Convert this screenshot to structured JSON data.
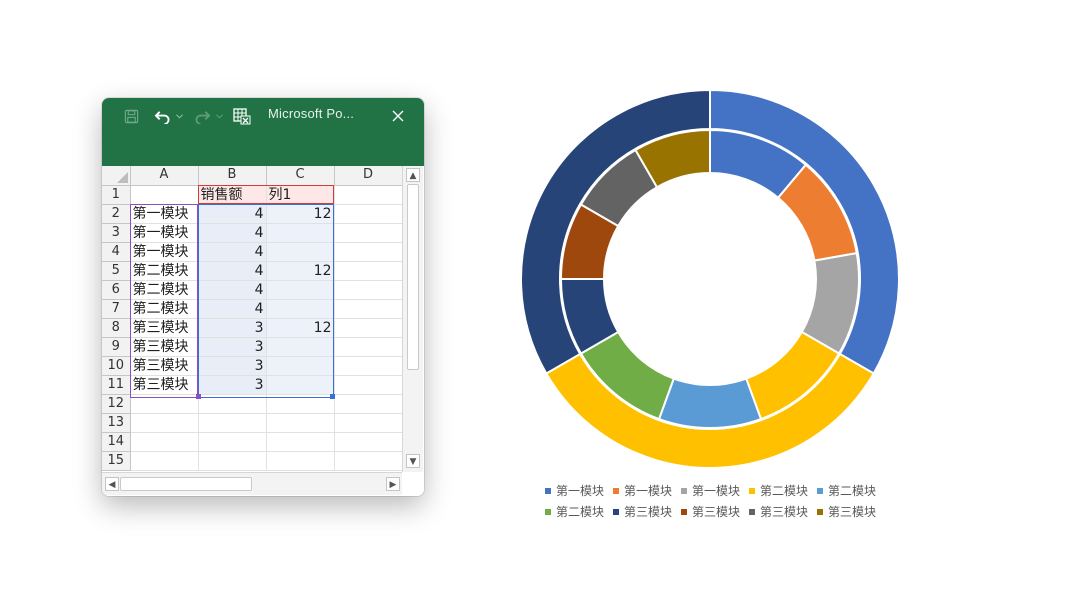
{
  "window": {
    "title": "Microsoft Po...",
    "icons": [
      "save-icon",
      "undo-icon",
      "undo-dropdown-icon",
      "redo-icon",
      "redo-dropdown-icon",
      "spreadsheet-icon",
      "close-icon"
    ]
  },
  "sheet": {
    "columns": [
      "A",
      "B",
      "C",
      "D"
    ],
    "rows": [
      {
        "num": "1",
        "a": "",
        "b": "销售额",
        "c": "列1",
        "d": ""
      },
      {
        "num": "2",
        "a": "第一模块",
        "b": "4",
        "c": "12",
        "d": ""
      },
      {
        "num": "3",
        "a": "第一模块",
        "b": "4",
        "c": "",
        "d": ""
      },
      {
        "num": "4",
        "a": "第一模块",
        "b": "4",
        "c": "",
        "d": ""
      },
      {
        "num": "5",
        "a": "第二模块",
        "b": "4",
        "c": "12",
        "d": ""
      },
      {
        "num": "6",
        "a": "第二模块",
        "b": "4",
        "c": "",
        "d": ""
      },
      {
        "num": "7",
        "a": "第二模块",
        "b": "4",
        "c": "",
        "d": ""
      },
      {
        "num": "8",
        "a": "第三模块",
        "b": "3",
        "c": "12",
        "d": ""
      },
      {
        "num": "9",
        "a": "第三模块",
        "b": "3",
        "c": "",
        "d": ""
      },
      {
        "num": "10",
        "a": "第三模块",
        "b": "3",
        "c": "",
        "d": ""
      },
      {
        "num": "11",
        "a": "第三模块",
        "b": "3",
        "c": "",
        "d": ""
      },
      {
        "num": "12",
        "a": "",
        "b": "",
        "c": "",
        "d": ""
      },
      {
        "num": "13",
        "a": "",
        "b": "",
        "c": "",
        "d": ""
      },
      {
        "num": "14",
        "a": "",
        "b": "",
        "c": "",
        "d": ""
      },
      {
        "num": "15",
        "a": "",
        "b": "",
        "c": "",
        "d": ""
      }
    ]
  },
  "chart_data": {
    "type": "doughnut",
    "title": "",
    "series": [
      {
        "name": "列1",
        "ring": "outer",
        "values": [
          12,
          12,
          12
        ],
        "colors": [
          "#4472C4",
          "#FFC000",
          "#264478"
        ]
      },
      {
        "name": "销售额",
        "ring": "inner",
        "values": [
          4,
          4,
          4,
          4,
          4,
          4,
          3,
          3,
          3,
          3
        ],
        "colors": [
          "#4472C4",
          "#ED7D31",
          "#A5A5A5",
          "#FFC000",
          "#5B9BD5",
          "#70AD47",
          "#264478",
          "#9E480E",
          "#636363",
          "#997300"
        ]
      }
    ],
    "legend": {
      "position": "bottom",
      "entries": [
        {
          "label": "第一模块",
          "color": "#4472C4"
        },
        {
          "label": "第一模块",
          "color": "#ED7D31"
        },
        {
          "label": "第一模块",
          "color": "#A5A5A5"
        },
        {
          "label": "第二模块",
          "color": "#FFC000"
        },
        {
          "label": "第二模块",
          "color": "#5B9BD5"
        },
        {
          "label": "第二模块",
          "color": "#70AD47"
        },
        {
          "label": "第三模块",
          "color": "#264478"
        },
        {
          "label": "第三模块",
          "color": "#9E480E"
        },
        {
          "label": "第三模块",
          "color": "#636363"
        },
        {
          "label": "第三模块",
          "color": "#997300"
        }
      ]
    }
  }
}
